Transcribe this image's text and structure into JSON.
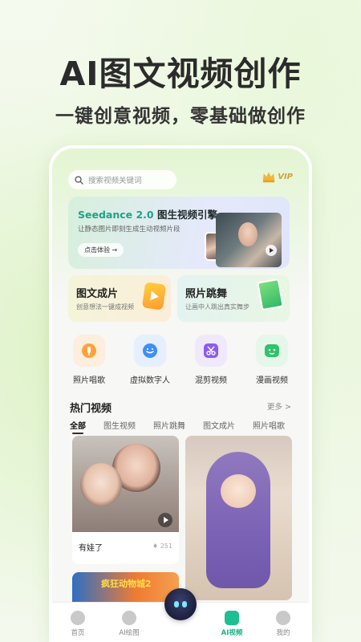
{
  "hero": {
    "title": "AI图文视频创作",
    "subtitle": "一键创意视频，零基础做创作"
  },
  "app": {
    "search": {
      "placeholder": "搜索视频关键词"
    },
    "vip_label": "VIP",
    "banner": {
      "brand": "Seedance 2.0",
      "title": "图生视频引擎",
      "subtitle": "让静态图片即刻生成生动视频片段",
      "cta": "点击体验 →"
    },
    "feature_cards": [
      {
        "title": "图文成片",
        "subtitle": "创意想法一键成视频"
      },
      {
        "title": "照片跳舞",
        "subtitle": "让画中人跳出真实舞步"
      }
    ],
    "quick_actions": [
      {
        "label": "照片唱歌",
        "icon": "microphone-icon"
      },
      {
        "label": "虚拟数字人",
        "icon": "chat-bubble-icon"
      },
      {
        "label": "混剪视频",
        "icon": "scissors-icon"
      },
      {
        "label": "漫画视频",
        "icon": "comic-icon"
      }
    ],
    "hot_section": {
      "title": "热门视频",
      "more": "更多 >",
      "tabs": [
        "全部",
        "图生视频",
        "照片跳舞",
        "图文成片",
        "照片唱歌"
      ],
      "active_tab": "全部"
    },
    "feed": [
      {
        "caption": "有娃了",
        "likes": "251"
      },
      {
        "caption": ""
      },
      {
        "caption": "疯狂动物城2"
      }
    ],
    "bottom_nav": [
      {
        "label": "首页",
        "icon": "home-icon"
      },
      {
        "label": "AI绘图",
        "icon": "paint-icon"
      },
      {
        "label": "AI视频",
        "icon": "video-icon"
      },
      {
        "label": "我的",
        "icon": "user-icon"
      }
    ],
    "colors": {
      "accent": "#1fbf93",
      "vip_gold": "#d3a23a"
    }
  }
}
